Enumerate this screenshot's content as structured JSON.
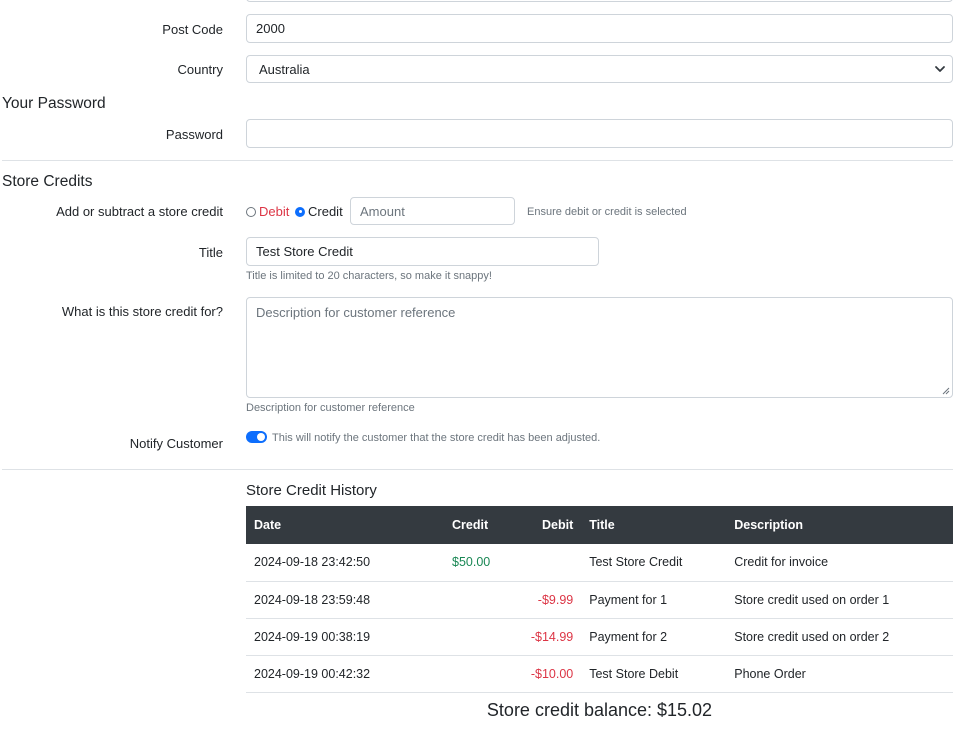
{
  "address": {
    "postcode_label": "Post Code",
    "postcode_value": "2000",
    "country_label": "Country",
    "country_value": "Australia"
  },
  "password_section": {
    "title": "Your Password",
    "password_label": "Password",
    "password_value": ""
  },
  "store_credits": {
    "title": "Store Credits",
    "adjust_label": "Add or subtract a store credit",
    "debit_label": "Debit",
    "credit_label": "Credit",
    "selected": "credit",
    "amount_placeholder": "Amount",
    "adjust_help": "Ensure debit or credit is selected",
    "title_label": "Title",
    "title_value": "Test Store Credit",
    "title_help": "Title is limited to 20 characters, so make it snappy!",
    "for_label": "What is this store credit for?",
    "for_placeholder": "Description for customer reference",
    "for_help": "Description for customer reference",
    "notify_label": "Notify Customer",
    "notify_on": true,
    "notify_help": "This will notify the customer that the store credit has been adjusted.",
    "debit_color": "#dc3545",
    "accent_color": "#0d6efd"
  },
  "history": {
    "title": "Store Credit History",
    "columns": [
      "Date",
      "Credit",
      "Debit",
      "Title",
      "Description"
    ],
    "rows": [
      {
        "date": "2024-09-18 23:42:50",
        "credit": "$50.00",
        "debit": "",
        "title": "Test Store Credit",
        "description": "Credit for invoice"
      },
      {
        "date": "2024-09-18 23:59:48",
        "credit": "",
        "debit": "-$9.99",
        "title": "Payment for 1",
        "description": "Store credit used on order 1"
      },
      {
        "date": "2024-09-19 00:38:19",
        "credit": "",
        "debit": "-$14.99",
        "title": "Payment for 2",
        "description": "Store credit used on order 2"
      },
      {
        "date": "2024-09-19 00:42:32",
        "credit": "",
        "debit": "-$10.00",
        "title": "Test Store Debit",
        "description": "Phone Order"
      }
    ],
    "balance": "Store credit balance: $15.02",
    "header_color": "#343a40",
    "credit_color": "#198754"
  },
  "icons": {
    "country_select": "chevron-down-icon",
    "textarea_resize": "resize-grip-icon"
  }
}
